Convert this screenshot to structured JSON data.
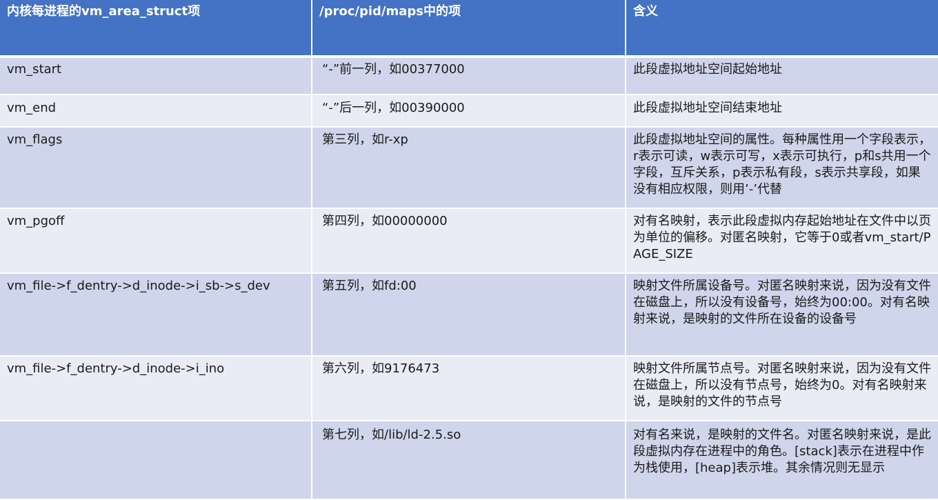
{
  "header": {
    "col1": "内核每进程的vm_area_struct项",
    "col2": "/proc/pid/maps中的项",
    "col3": "含义"
  },
  "rows": [
    {
      "field": "vm_start",
      "maps": "“-”前一列，如00377000",
      "meaning": "此段虚拟地址空间起始地址"
    },
    {
      "field": "vm_end",
      "maps": "“-”后一列，如00390000",
      "meaning": "此段虚拟地址空间结束地址"
    },
    {
      "field": "vm_flags",
      "maps": "第三列，如r-xp",
      "meaning": "此段虚拟地址空间的属性。每种属性用一个字段表示，r表示可读，w表示可写，x表示可执行，p和s共用一个字段，互斥关系，p表示私有段，s表示共享段，如果没有相应权限，则用’-’代替"
    },
    {
      "field": "vm_pgoff",
      "maps": "第四列，如00000000",
      "meaning": "对有名映射，表示此段虚拟内存起始地址在文件中以页为单位的偏移。对匿名映射，它等于0或者vm_start/PAGE_SIZE"
    },
    {
      "field": "vm_file->f_dentry->d_inode->i_sb->s_dev",
      "maps": "第五列，如fd:00",
      "meaning": "映射文件所属设备号。对匿名映射来说，因为没有文件在磁盘上，所以没有设备号，始终为00:00。对有名映射来说，是映射的文件所在设备的设备号"
    },
    {
      "field": "vm_file->f_dentry->d_inode->i_ino",
      "maps": "第六列，如9176473",
      "meaning": "映射文件所属节点号。对匿名映射来说，因为没有文件在磁盘上，所以没有节点号，始终为0。对有名映射来说，是映射的文件的节点号"
    },
    {
      "field": "",
      "maps": "第七列，如/lib/ld-2.5.so",
      "meaning": "对有名来说，是映射的文件名。对匿名映射来说，是此段虚拟内存在进程中的角色。[stack]表示在进程中作为栈使用，[heap]表示堆。其余情况则无显示"
    }
  ]
}
